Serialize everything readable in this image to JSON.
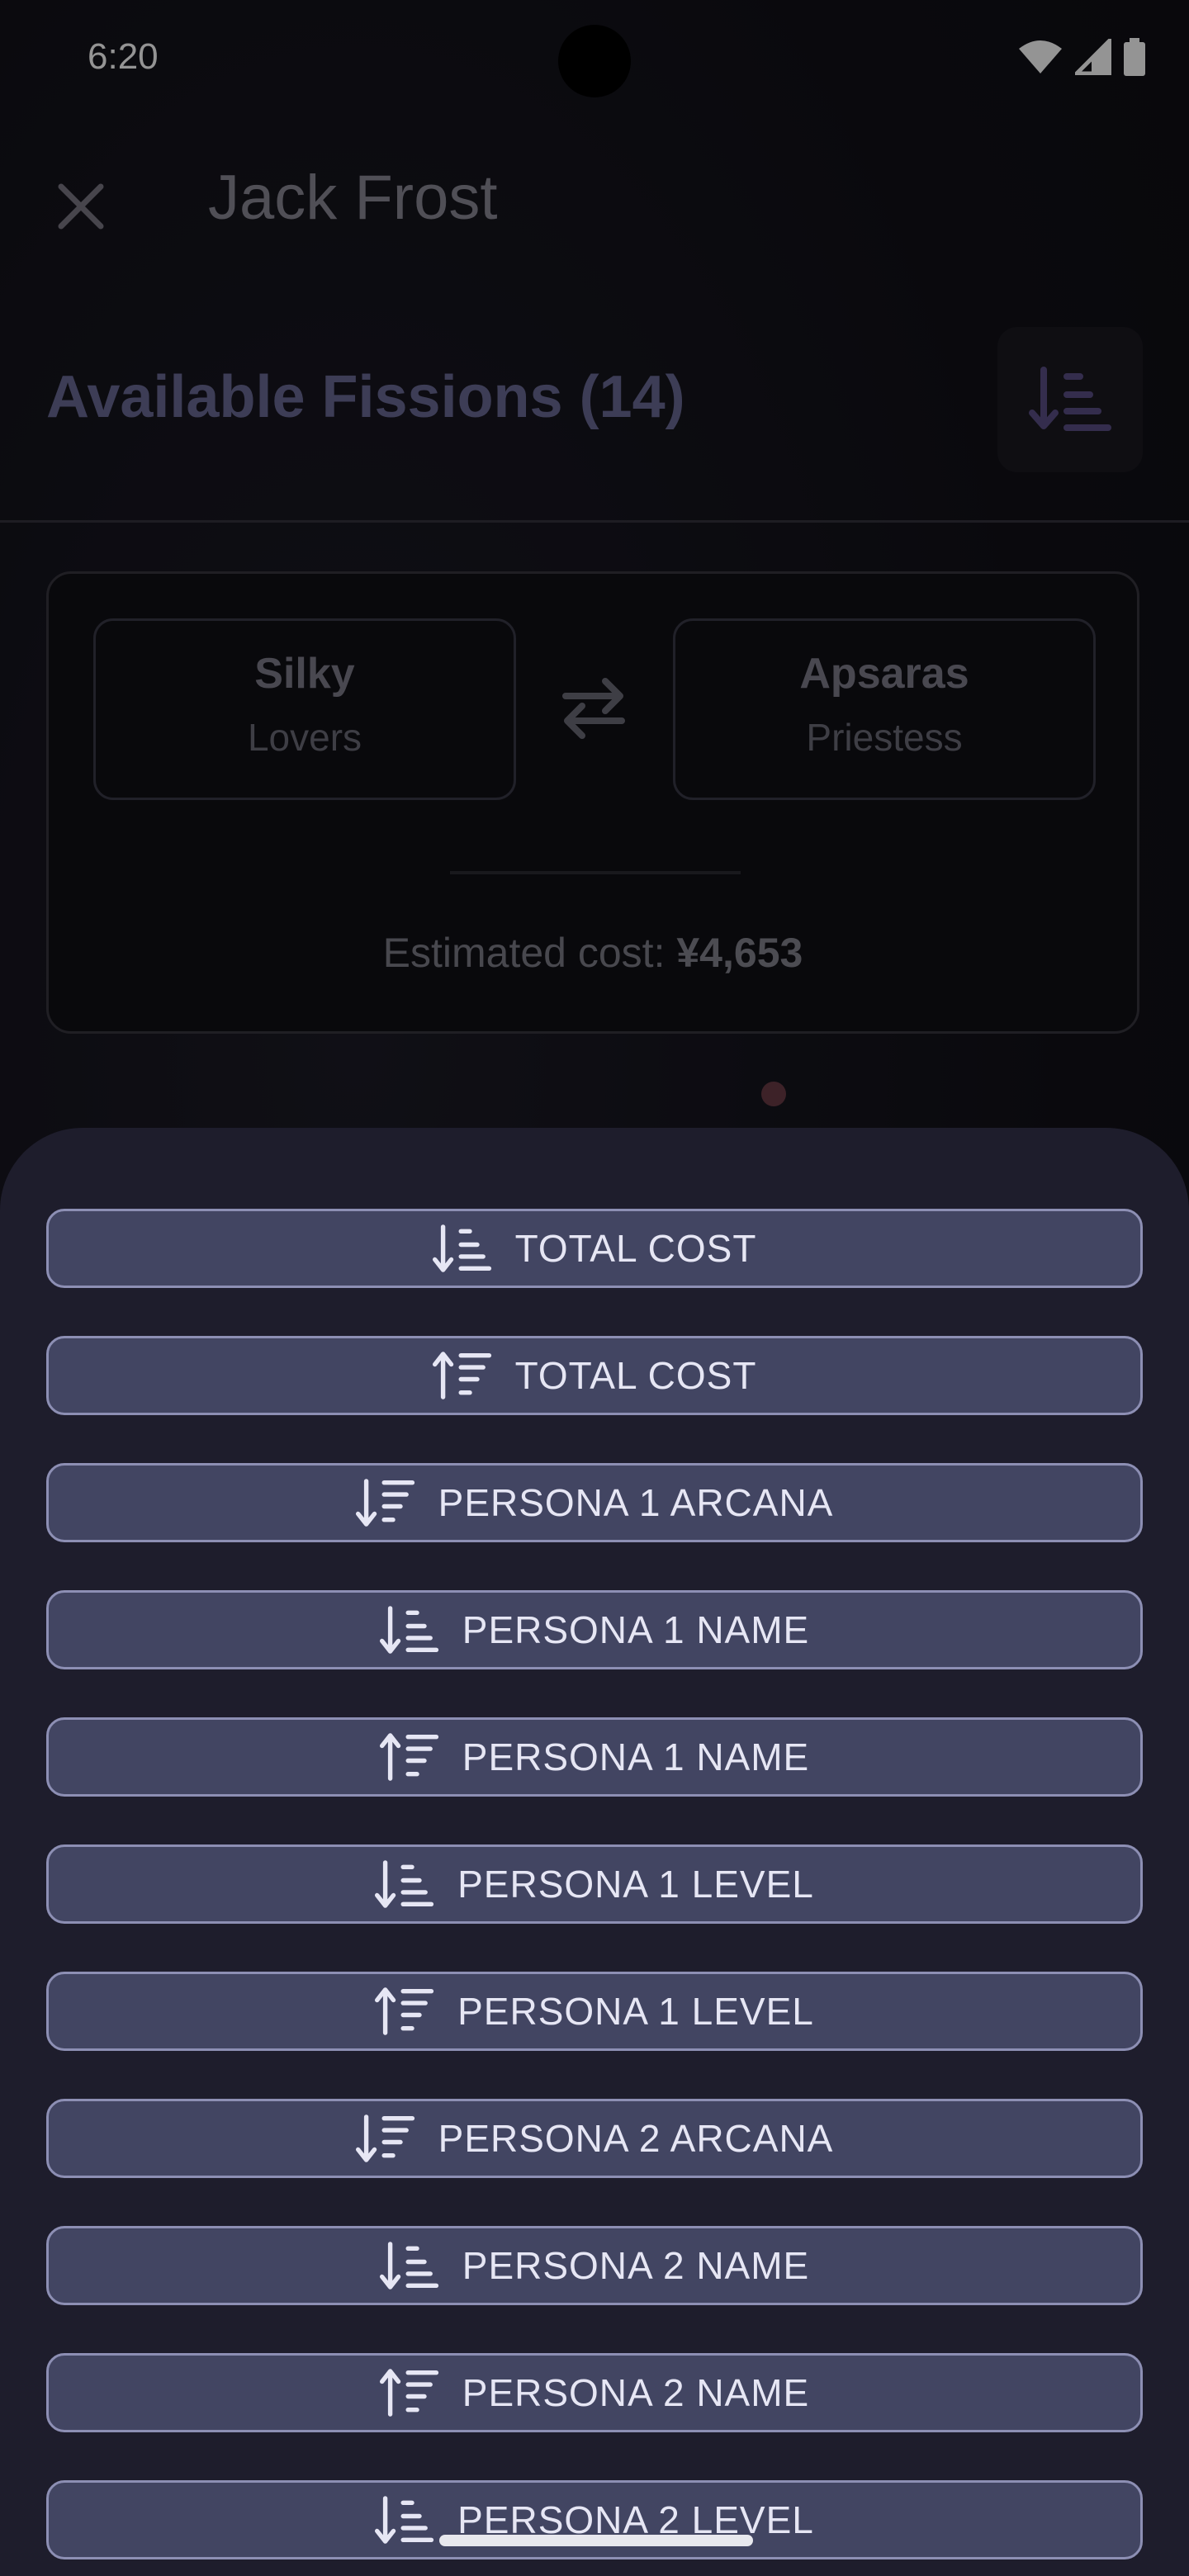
{
  "status_bar": {
    "time": "6:20",
    "icons": [
      "wifi-icon",
      "signal-icon",
      "battery-icon"
    ]
  },
  "app_bar": {
    "close_icon": "close-icon",
    "title": "Jack Frost"
  },
  "header": {
    "section_title": "Available Fissions (14)",
    "sort_icon": "sort-ascending-icon"
  },
  "fission_card": {
    "persona1": {
      "name": "Silky",
      "arcana": "Lovers"
    },
    "swap_icon": "swap-horizontal-icon",
    "persona2": {
      "name": "Apsaras",
      "arcana": "Priestess"
    },
    "estimate_label": "Estimated cost: ",
    "estimate_value": "¥4,653"
  },
  "sort_sheet": {
    "options": [
      {
        "label": "TOTAL COST",
        "icon": "sort-ascending-icon"
      },
      {
        "label": "TOTAL COST",
        "icon": "sort-descending-icon"
      },
      {
        "label": "PERSONA 1 ARCANA",
        "icon": "sort-variant-icon"
      },
      {
        "label": "PERSONA 1 NAME",
        "icon": "sort-ascending-icon"
      },
      {
        "label": "PERSONA 1 NAME",
        "icon": "sort-descending-icon"
      },
      {
        "label": "PERSONA 1 LEVEL",
        "icon": "sort-ascending-icon"
      },
      {
        "label": "PERSONA 1 LEVEL",
        "icon": "sort-descending-icon"
      },
      {
        "label": "PERSONA 2 ARCANA",
        "icon": "sort-variant-icon"
      },
      {
        "label": "PERSONA 2 NAME",
        "icon": "sort-ascending-icon"
      },
      {
        "label": "PERSONA 2 NAME",
        "icon": "sort-descending-icon"
      },
      {
        "label": "PERSONA 2 LEVEL",
        "icon": "sort-ascending-icon"
      }
    ]
  },
  "colors": {
    "sheet_background": "#1e1d2c",
    "option_background": "#424562",
    "option_border": "#8d8fb4",
    "option_text": "#e6e6f4",
    "accent_purple": "#5b4f86"
  }
}
